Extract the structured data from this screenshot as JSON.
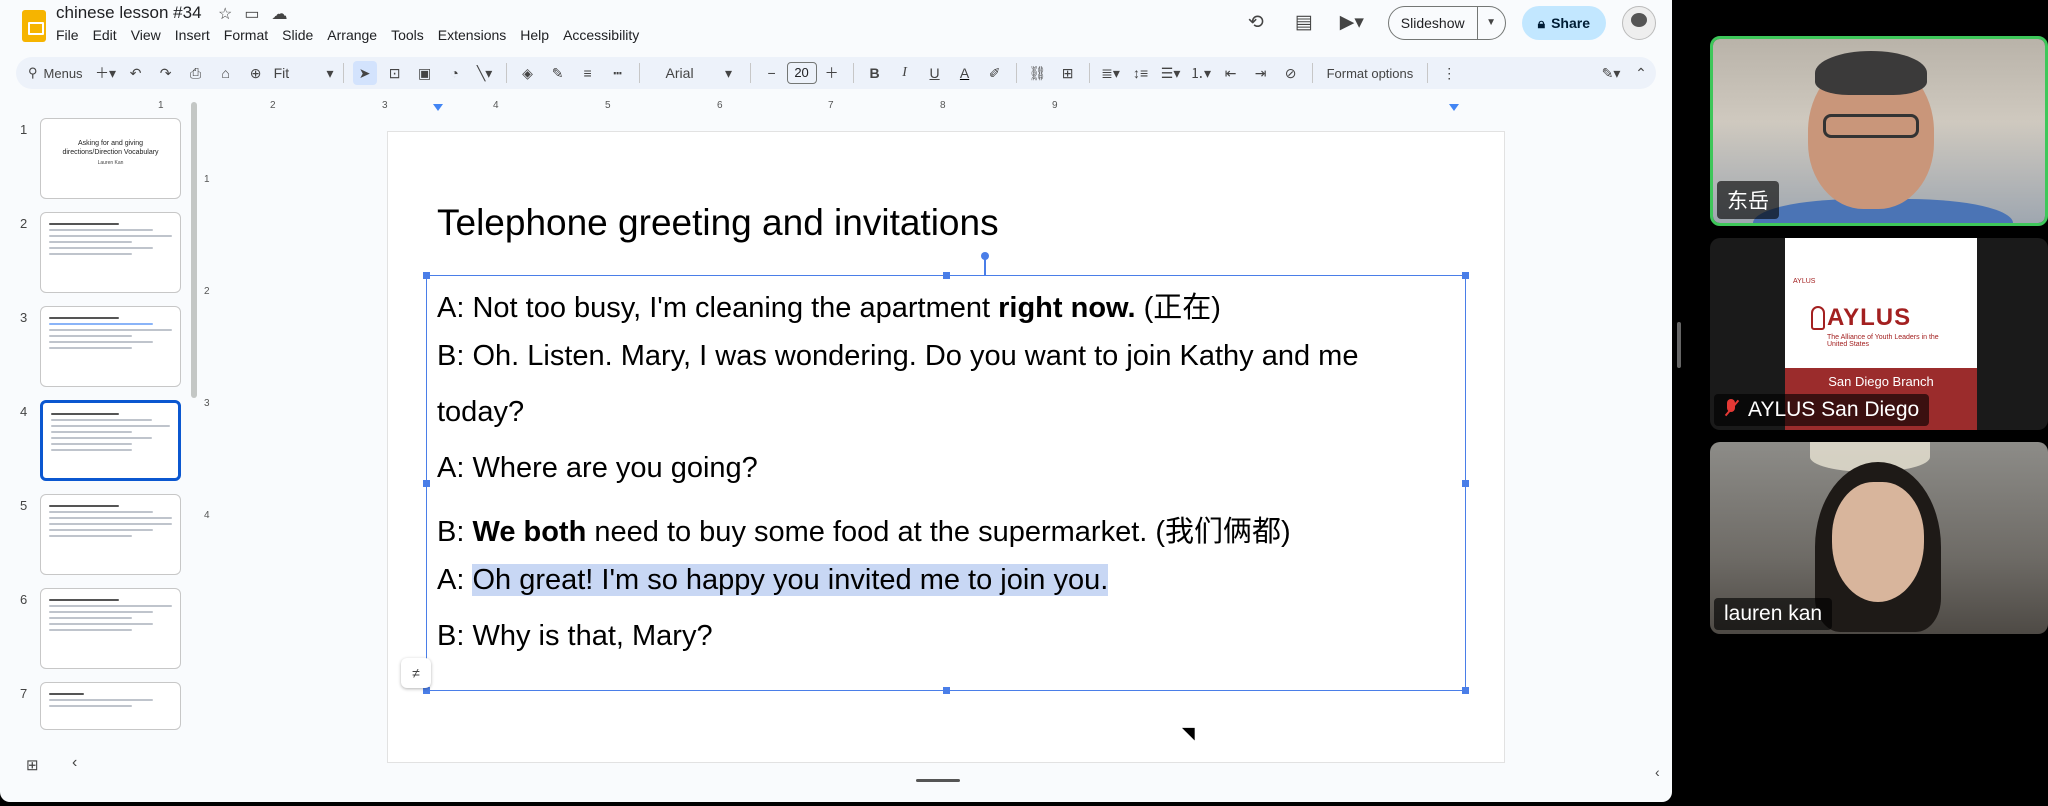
{
  "app": {
    "doc_title": "chinese lesson #34",
    "menu": [
      "File",
      "Edit",
      "View",
      "Insert",
      "Format",
      "Slide",
      "Arrange",
      "Tools",
      "Extensions",
      "Help",
      "Accessibility"
    ],
    "slideshow_label": "Slideshow",
    "share_label": "Share"
  },
  "toolbar": {
    "menus_label": "Menus",
    "zoom_label": "Fit",
    "font": "Arial",
    "font_size": "20",
    "format_options_label": "Format options"
  },
  "filmstrip": {
    "slides": [
      {
        "num": "1",
        "title": "Asking for and giving directions/Direction Vocabulary",
        "subtitle": "Lauren Kan"
      },
      {
        "num": "2",
        "title": "Vocabulary"
      },
      {
        "num": "3",
        "title": "Telephone greeting and invitations"
      },
      {
        "num": "4",
        "title": "Telephone greeting and invitations"
      },
      {
        "num": "5",
        "title": "Telephone greeting and invitations"
      },
      {
        "num": "6",
        "title": "Telephone greeting and invitations"
      },
      {
        "num": "7",
        "title": "词组题"
      }
    ],
    "selected": "4"
  },
  "rulers": {
    "horizontal": [
      "1",
      "2",
      "3",
      "4",
      "5",
      "6",
      "7",
      "8",
      "9"
    ],
    "vertical": [
      "1",
      "2",
      "3",
      "4"
    ]
  },
  "slide": {
    "title": "Telephone greeting and invitations",
    "lines": [
      {
        "pre": "A: Not too busy, I'm cleaning the apartment ",
        "bold": "right now.",
        "post": " (正在)"
      },
      {
        "pre": "B: Oh. Listen. Mary, I was wondering. Do you want to join Kathy and me",
        "bold": "",
        "post": ""
      },
      {
        "pre": "today?",
        "bold": "",
        "post": ""
      },
      {
        "pre": "A: Where are you going?",
        "bold": "",
        "post": ""
      },
      {
        "pre": "B: ",
        "bold": "We both",
        "post": " need to buy some food at the supermarket. (我们俩都)"
      },
      {
        "pre": "A: ",
        "highlight": "Oh great! I'm so happy you invited me to join you.",
        "post": ""
      },
      {
        "pre": "B: Why is that, Mary?",
        "bold": "",
        "post": ""
      }
    ]
  },
  "video_panel": {
    "tiles": [
      {
        "name": "东岳",
        "active": true
      },
      {
        "name": "AYLUS San Diego",
        "muted": true,
        "logo_text": "AYLUS",
        "logo_small": "AYLUS",
        "logo_tagline": "The Alliance of Youth Leaders in the United States",
        "branch": "San Diego Branch"
      },
      {
        "name": "lauren kan"
      }
    ]
  },
  "colors": {
    "selection_blue": "#4a7ee8",
    "highlight": "#c8d7f4",
    "share_bg": "#c2e7ff",
    "active_speaker": "#3ec75a",
    "aylus_red": "#9b2c2c"
  }
}
